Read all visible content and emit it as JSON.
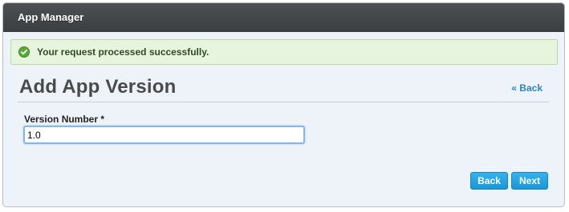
{
  "window": {
    "title": "App Manager"
  },
  "alert": {
    "icon": "check-circle-icon",
    "message": "Your request processed successfully.",
    "color": "#e7f4de"
  },
  "page": {
    "heading": "Add App Version",
    "back_link": "« Back"
  },
  "form": {
    "version_label": "Version Number *",
    "version_value": "1.0"
  },
  "actions": {
    "back_label": "Back",
    "next_label": "Next",
    "accent": "#1a96d6"
  }
}
